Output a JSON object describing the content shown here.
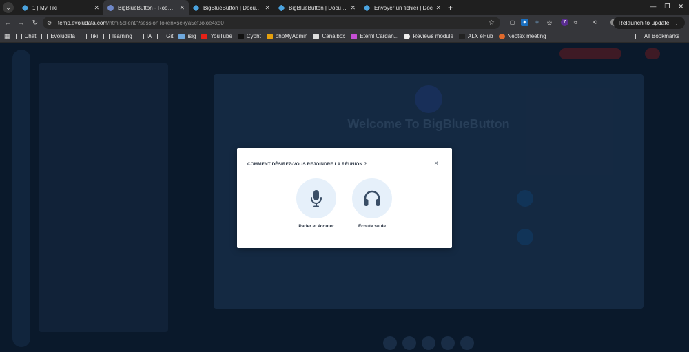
{
  "browser": {
    "tabs": [
      {
        "title": "1 | My Tiki",
        "active": false
      },
      {
        "title": "BigBlueButton - Room-N",
        "active": true
      },
      {
        "title": "BigBlueButton | Docume",
        "active": false
      },
      {
        "title": "BigBlueButton | Docume",
        "active": false
      },
      {
        "title": "Envoyer un fichier | Doc",
        "active": false
      }
    ],
    "new_tab": "+",
    "address": {
      "host": "temp.evoludata.com",
      "path": "/html5client/?sessionToken=sekya5ef.xxoe4xq0"
    },
    "relaunch_label": "Relaunch to update",
    "extension_badge": "7",
    "bookmarks": [
      {
        "label": "Chat",
        "icon": "folder-icon"
      },
      {
        "label": "Evoludata",
        "icon": "folder-icon"
      },
      {
        "label": "Tiki",
        "icon": "folder-icon"
      },
      {
        "label": "learning",
        "icon": "folder-icon"
      },
      {
        "label": "IA",
        "icon": "folder-icon"
      },
      {
        "label": "Git",
        "icon": "folder-icon"
      },
      {
        "label": "isig",
        "icon": "isig-icon"
      },
      {
        "label": "YouTube",
        "icon": "youtube-icon"
      },
      {
        "label": "Cypht",
        "icon": "cypht-icon"
      },
      {
        "label": "phpMyAdmin",
        "icon": "phpmyadmin-icon"
      },
      {
        "label": "Canalbox",
        "icon": "canalbox-icon"
      },
      {
        "label": "Eternl Cardan...",
        "icon": "eternl-icon"
      },
      {
        "label": "Reviews module",
        "icon": "reviews-icon"
      },
      {
        "label": "ALX eHub",
        "icon": "alx-icon"
      },
      {
        "label": "Neotex meeting",
        "icon": "neotex-icon"
      }
    ],
    "all_bookmarks": "All Bookmarks"
  },
  "page": {
    "background_title": "Welcome To BigBlueButton"
  },
  "modal": {
    "title": "COMMENT DÉSIREZ-VOUS REJOINDRE LA RÉUNION ?",
    "close": "×",
    "options": [
      {
        "label": "Parler et écouter",
        "icon": "microphone-icon"
      },
      {
        "label": "Écoute seule",
        "icon": "headphones-icon"
      }
    ]
  },
  "colors": {
    "accent": "#3a4e66",
    "option_bg": "#e6f0fa",
    "page_bg": "#0d1e34"
  }
}
